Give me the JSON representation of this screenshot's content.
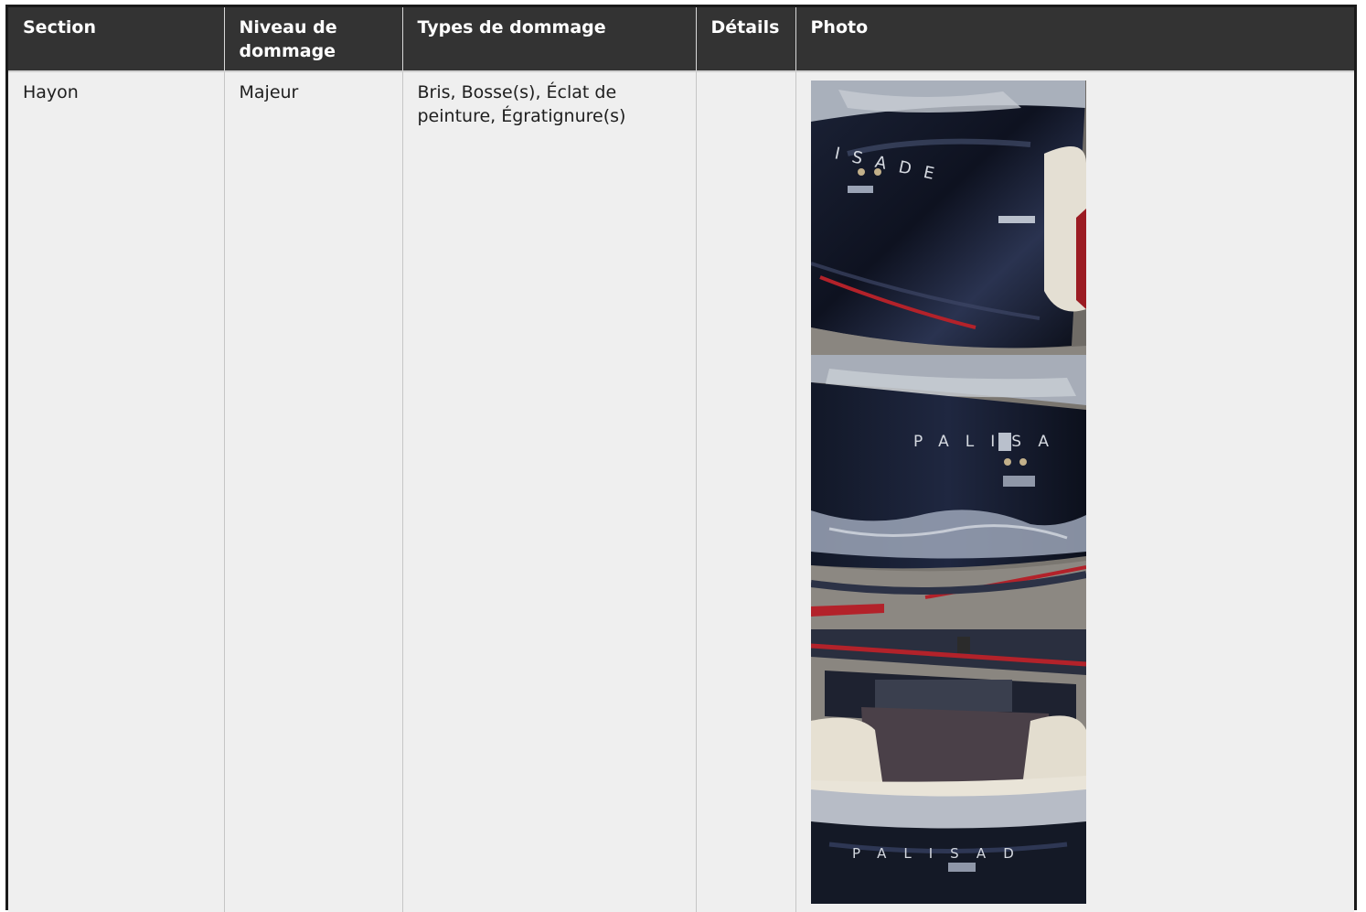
{
  "table": {
    "headers": [
      "Section",
      "Niveau de dommage",
      "Types de dommage",
      "Détails",
      "Photo"
    ],
    "rows": [
      {
        "section": "Hayon",
        "niveau": "Majeur",
        "types": "Bris, Bosse(s), Éclat de peinture, Égratignure(s)",
        "details": ""
      }
    ]
  },
  "photos": {
    "photo1": {
      "badge_letters": "ISADE"
    },
    "photo2": {
      "badge_letters": "PALISA"
    },
    "photo3": {
      "badge_letters": "PALISAD"
    }
  }
}
